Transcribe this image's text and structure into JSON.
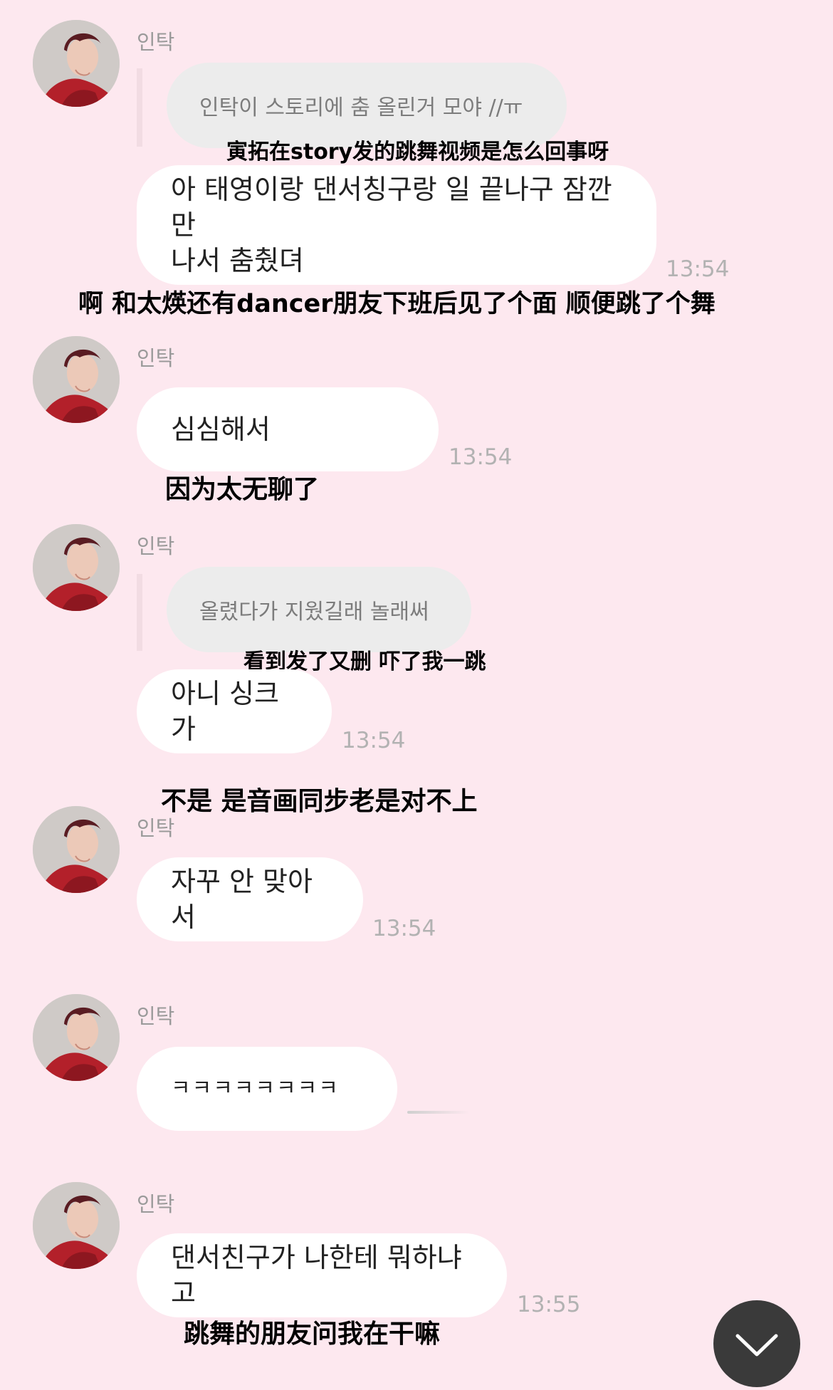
{
  "chat": {
    "sender_name": "인탁",
    "messages": [
      {
        "quote": "인탁이 스토리에 춤 올린거 모야 //ㅠ",
        "quote_translation": "寅拓在story发的跳舞视频是怎么回事呀",
        "text": "아 태영이랑 댄서칭구랑 일 끝나구 잠깐 만\n나서 춤췄뎌",
        "time": "13:54",
        "translation": "啊 和太煐还有dancer朋友下班后见了个面 顺便跳了个舞"
      },
      {
        "text": "심심해서",
        "time": "13:54",
        "translation": "因为太无聊了"
      },
      {
        "quote": "올렸다가 지웠길래 놀래써",
        "quote_translation": "看到发了又删 吓了我一跳",
        "text": "아니 싱크가",
        "time": "13:54",
        "translation": "不是 是音画同步老是对不上"
      },
      {
        "text": "자꾸 안 맞아서",
        "time": "13:54"
      },
      {
        "text": "ㅋㅋㅋㅋㅋㅋㅋㅋ",
        "status": "sending"
      },
      {
        "text": "댄서친구가 나한테 뭐하냐고",
        "time": "13:55",
        "translation": "跳舞的朋友问我在干嘛"
      }
    ]
  },
  "controls": {
    "scroll_down_icon": "chevron-down-icon"
  },
  "colors": {
    "background": "#fde8ef",
    "bubble": "#ffffff",
    "quote_bubble": "#ececec",
    "timestamp": "#b2b2b2",
    "sender": "#9a9a9a"
  }
}
